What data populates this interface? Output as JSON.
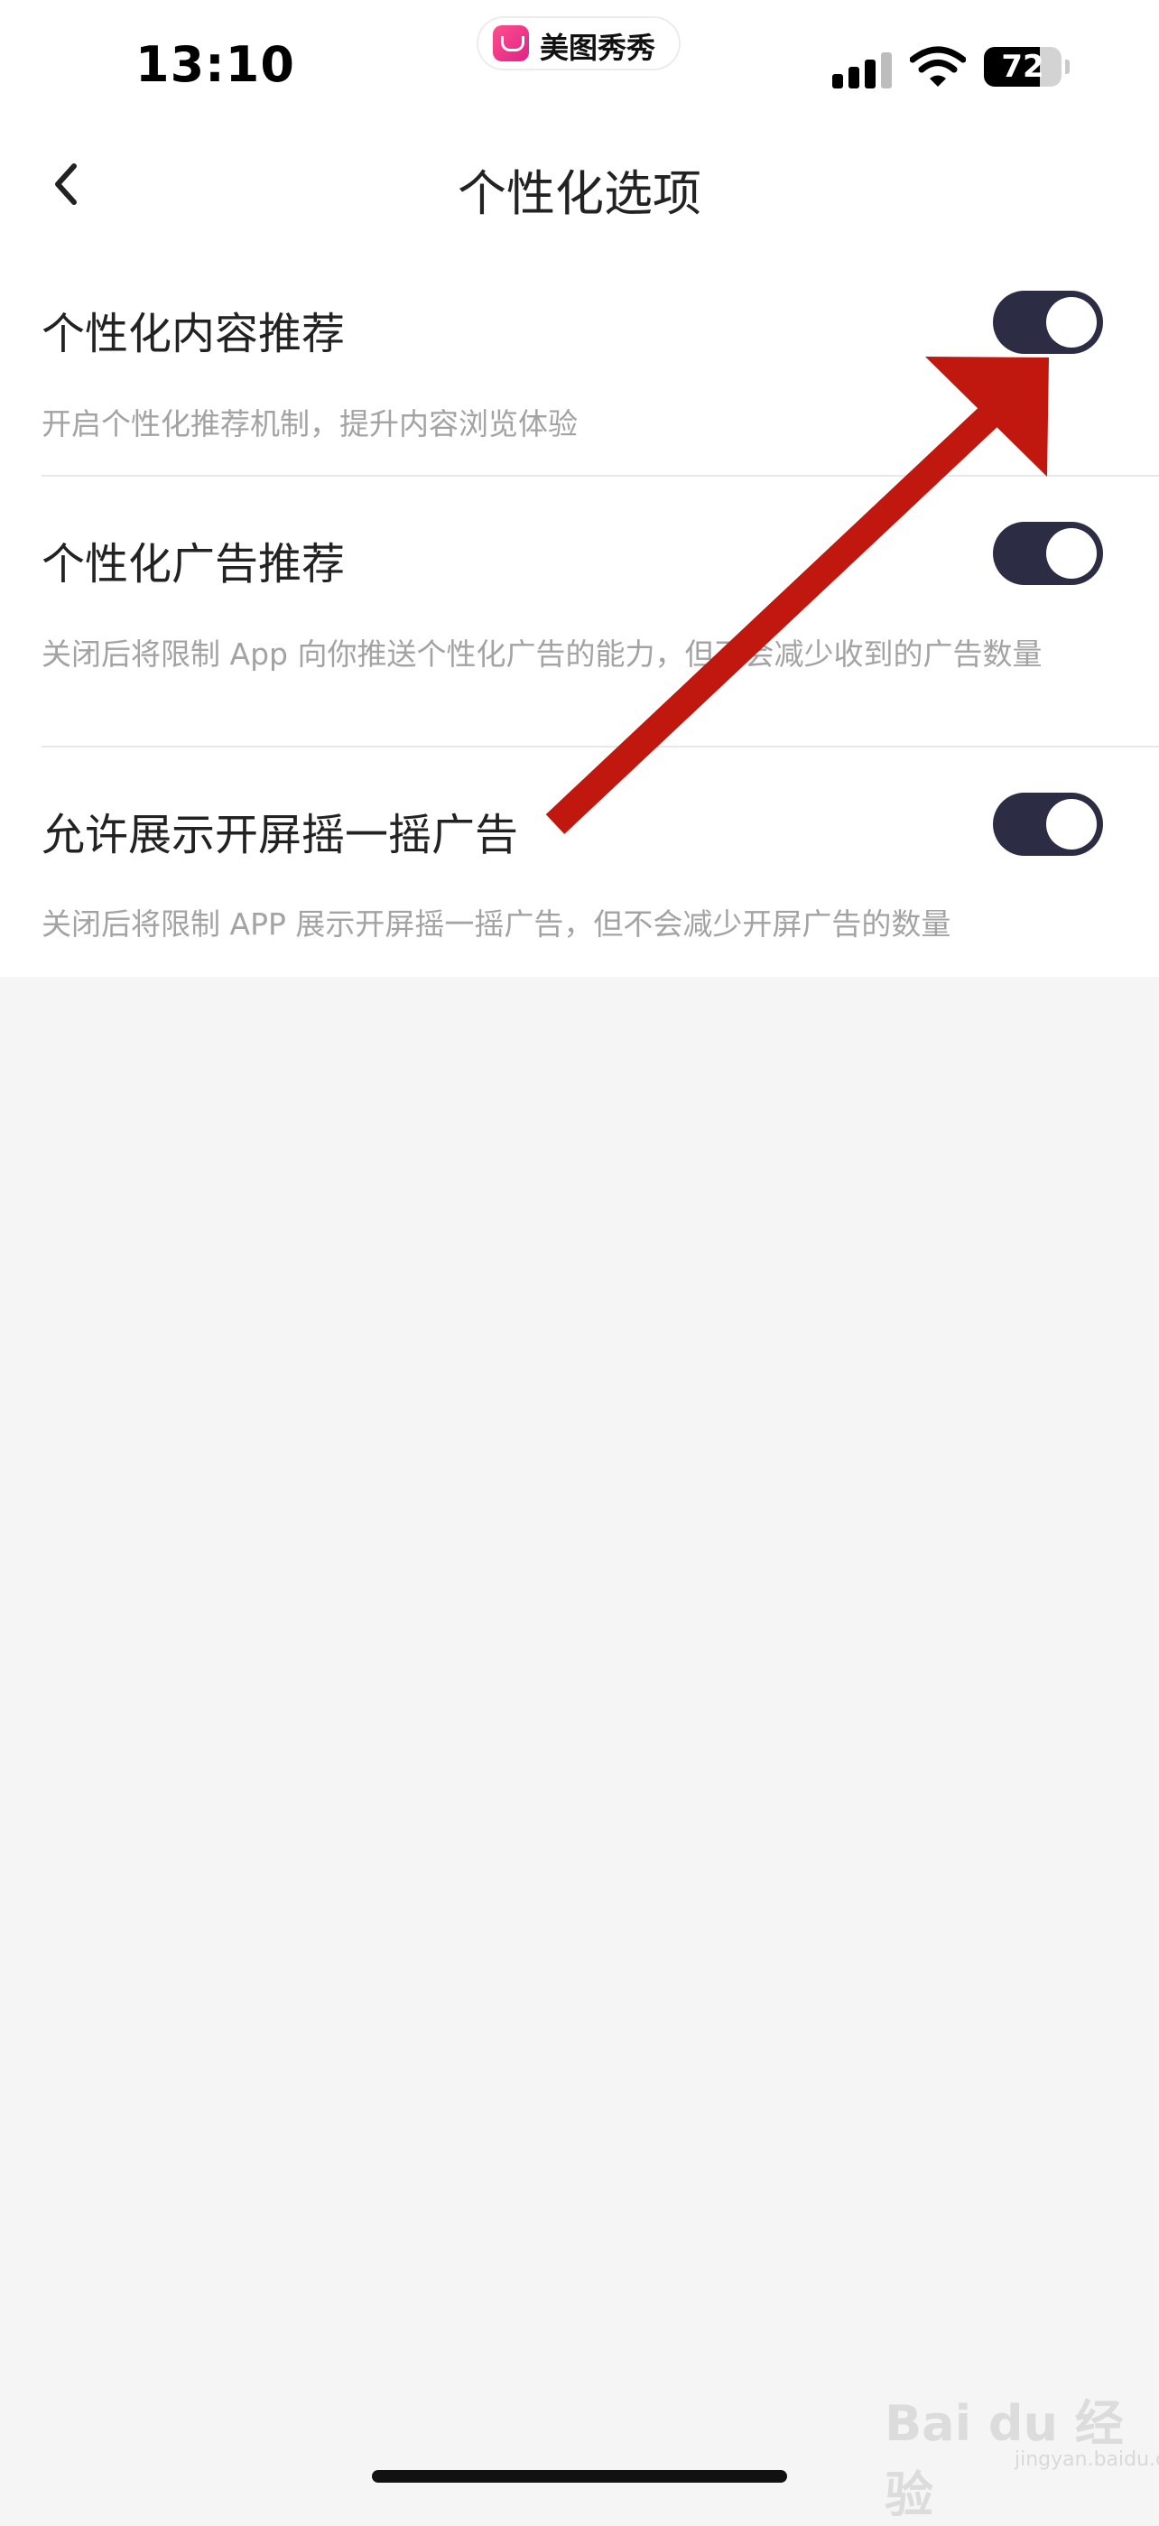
{
  "status_bar": {
    "time": "13:10",
    "app_pill_label": "美图秀秀",
    "battery_level": "72",
    "battery_fraction": 0.72,
    "icons": [
      "signal-icon",
      "wifi-icon",
      "battery-icon"
    ]
  },
  "nav": {
    "back_icon": "chevron-left-icon",
    "title": "个性化选项"
  },
  "settings": [
    {
      "title": "个性化内容推荐",
      "description": "开启个性化推荐机制，提升内容浏览体验",
      "enabled": true
    },
    {
      "title": "个性化广告推荐",
      "description": "关闭后将限制 App 向你推送个性化广告的能力，但不会减少收到的广告数量",
      "enabled": true
    },
    {
      "title": "允许展示开屏摇一摇广告",
      "description": "关闭后将限制 APP 展示开屏摇一摇广告，但不会减少开屏广告的数量",
      "enabled": true
    }
  ],
  "colors": {
    "toggle_on": "#2c2d45",
    "annotation_arrow": "#c0170f",
    "description_text": "#a3a3a3"
  },
  "watermark": {
    "main": "Bai du 经验",
    "sub": "jingyan.baidu.com"
  }
}
